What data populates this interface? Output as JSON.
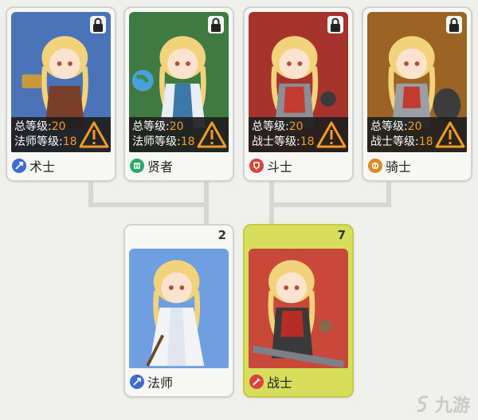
{
  "top_cards": [
    {
      "name": "术士",
      "total_label": "总等级:",
      "total_value": "20",
      "class_label": "法师等级:",
      "class_value": "18",
      "bg": "#4a73b8",
      "icon_color": "#3c6bd4",
      "icon": "mage-class-icon"
    },
    {
      "name": "贤者",
      "total_label": "总等级:",
      "total_value": "20",
      "class_label": "法师等级:",
      "class_value": "18",
      "bg": "#3f7a42",
      "icon_color": "#2ba86a",
      "icon": "sage-class-icon"
    },
    {
      "name": "斗士",
      "total_label": "总等级:",
      "total_value": "20",
      "class_label": "战士等级:",
      "class_value": "18",
      "bg": "#a7342c",
      "icon_color": "#d9443a",
      "icon": "fighter-class-icon"
    },
    {
      "name": "骑士",
      "total_label": "总等级:",
      "total_value": "20",
      "class_label": "战士等级:",
      "class_value": "18",
      "bg": "#9c6424",
      "icon_color": "#e2861e",
      "icon": "knight-class-icon"
    }
  ],
  "bottom_cards": [
    {
      "name": "法师",
      "count": "2",
      "bg": "#6f9fe0",
      "icon_color": "#3c6bd4",
      "card_bg": "#f7f7f5",
      "card_border": "#d2d2ce"
    },
    {
      "name": "战士",
      "count": "7",
      "bg": "#c8493a",
      "icon_color": "#d9443a",
      "card_bg": "#d6de5c",
      "card_border": "#c3cb45"
    }
  ],
  "watermark": {
    "text": "九游"
  }
}
